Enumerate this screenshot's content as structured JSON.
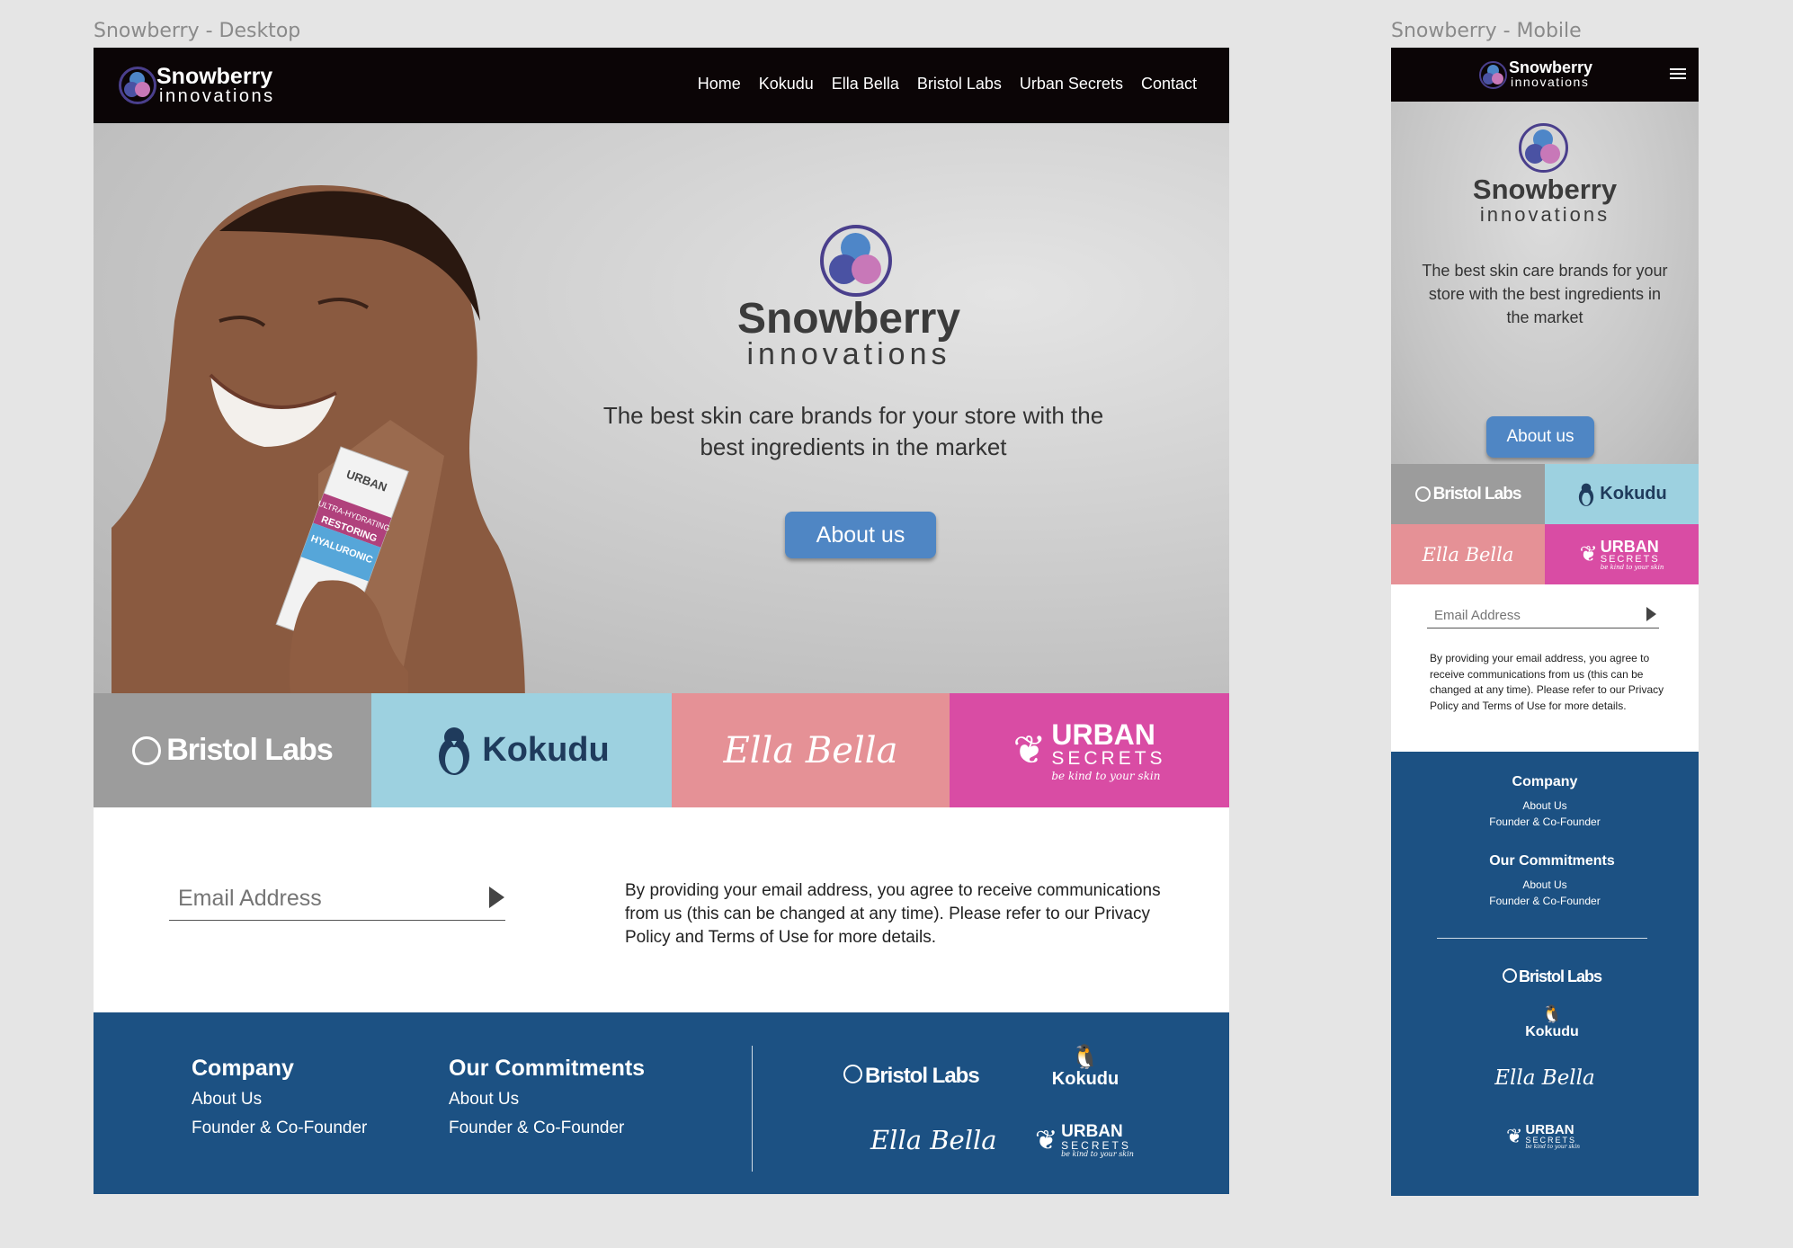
{
  "labels": {
    "desktop": "Snowberry - Desktop",
    "mobile": "Snowberry - Mobile"
  },
  "brand": {
    "name": "Snowberry",
    "sub": "innovations"
  },
  "colors": {
    "nav_bg": "#0b0506",
    "accent": "#4f86c4",
    "footer_bg": "#1c5183",
    "bristol": "#9c9c9c",
    "kokudu": "#9dd1e0",
    "ella": "#e59196",
    "urban": "#d94ca4"
  },
  "nav": {
    "items": [
      "Home",
      "Kokudu",
      "Ella Bella",
      "Bristol Labs",
      "Urban Secrets",
      "Contact"
    ],
    "menu_icon": "hamburger-icon"
  },
  "hero": {
    "tagline": "The best skin care brands for your store with the best ingredients in the market",
    "button": "About us",
    "product_box": {
      "brand": "URBAN",
      "line1": "ULTRA-HYDRATING",
      "line2": "RESTORING",
      "line3": "HYALURONIC"
    }
  },
  "brands": {
    "bristol": "Bristol Labs",
    "kokudu": "Kokudu",
    "ella": "Ella Bella",
    "urban_top": "URBAN",
    "urban_bottom": "SECRETS",
    "urban_tag": "be kind to your skin"
  },
  "subscribe": {
    "placeholder": "Email Address",
    "legal": "By providing your email address, you agree to receive communications from us (this can be changed at any time). Please refer to our Privacy Policy and Terms of Use for more details."
  },
  "footer": {
    "company": {
      "heading": "Company",
      "links": [
        "About Us",
        "Founder & Co-Founder"
      ]
    },
    "commitments": {
      "heading": "Our Commitments",
      "links": [
        "About Us",
        "Founder & Co-Founder"
      ]
    }
  }
}
